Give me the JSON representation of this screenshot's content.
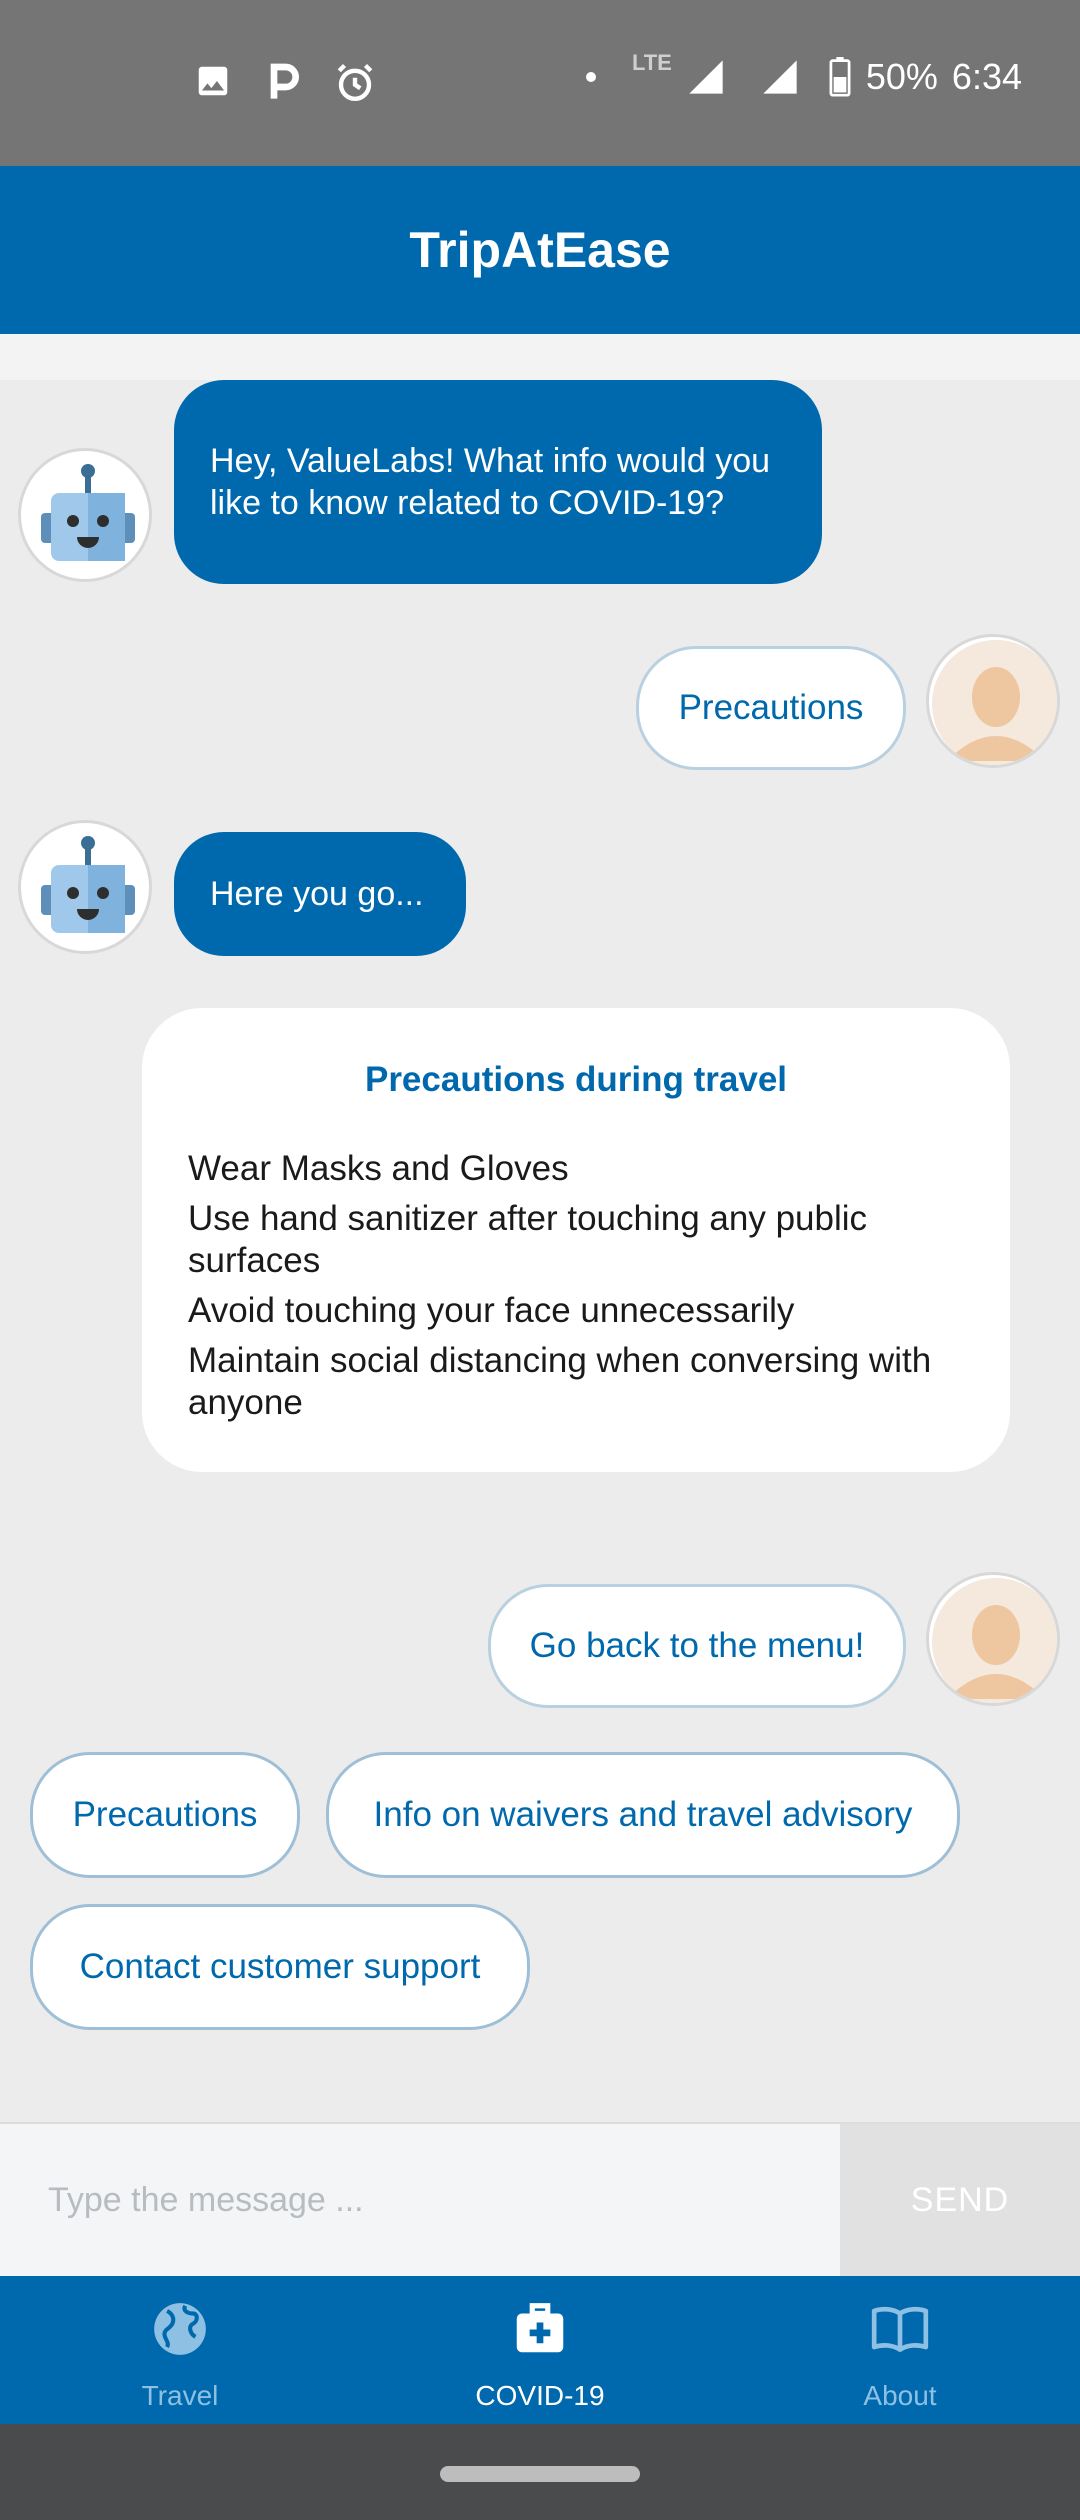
{
  "status_bar": {
    "battery": "50%",
    "time": "6:34",
    "network": "LTE",
    "icons": [
      "image-icon",
      "parking-icon",
      "alarm-icon",
      "dot-icon",
      "signal-icon",
      "signal-icon-2",
      "battery-icon"
    ]
  },
  "app": {
    "title": "TripAtEase",
    "accent": "#0069ad"
  },
  "chat": {
    "bot_greeting": "Hey, ValueLabs! What info would you like to know related to COVID-19?",
    "user_msg_1": "Precautions",
    "bot_reply": "Here you go...",
    "card": {
      "title": "Precautions during travel",
      "items": [
        "Wear Masks and Gloves",
        "Use hand sanitizer after touching any public surfaces",
        "Avoid touching your face unnecessarily",
        "Maintain social distancing when conversing with anyone"
      ]
    },
    "user_msg_2": "Go back to the menu!"
  },
  "quick_replies": [
    "Precautions",
    "Info on waivers and travel advisory",
    "Contact customer support"
  ],
  "input": {
    "placeholder": "Type the message ...",
    "value": "",
    "send_label": "SEND"
  },
  "nav": {
    "items": [
      {
        "label": "Travel",
        "icon": "globe-icon",
        "active": false
      },
      {
        "label": "COVID-19",
        "icon": "medical-kit-icon",
        "active": true
      },
      {
        "label": "About",
        "icon": "book-icon",
        "active": false
      }
    ]
  }
}
